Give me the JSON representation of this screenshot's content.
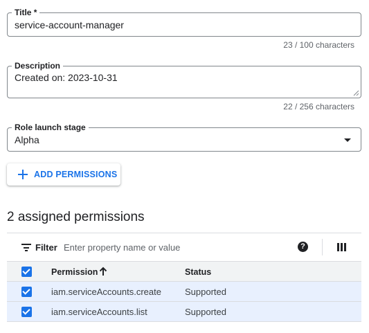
{
  "form": {
    "title": {
      "label": "Title *",
      "value": "service-account-manager",
      "counter": "23 / 100 characters"
    },
    "description": {
      "label": "Description",
      "value": "Created on: 2023-10-31",
      "counter": "22 / 256 characters"
    },
    "stage": {
      "label": "Role launch stage",
      "value": "Alpha"
    }
  },
  "add_button": {
    "label": "ADD PERMISSIONS",
    "icon": "plus-icon"
  },
  "permissions": {
    "heading": "2 assigned permissions",
    "filter": {
      "label": "Filter",
      "placeholder": "Enter property name or value"
    },
    "help_glyph": "?",
    "columns": [
      "Permission",
      "Status"
    ],
    "rows": [
      {
        "permission": "iam.serviceAccounts.create",
        "status": "Supported"
      },
      {
        "permission": "iam.serviceAccounts.list",
        "status": "Supported"
      }
    ]
  },
  "colors": {
    "accent": "#1a73e8",
    "selected_row": "#e8f0fe",
    "header_row": "#f1f3f4"
  }
}
